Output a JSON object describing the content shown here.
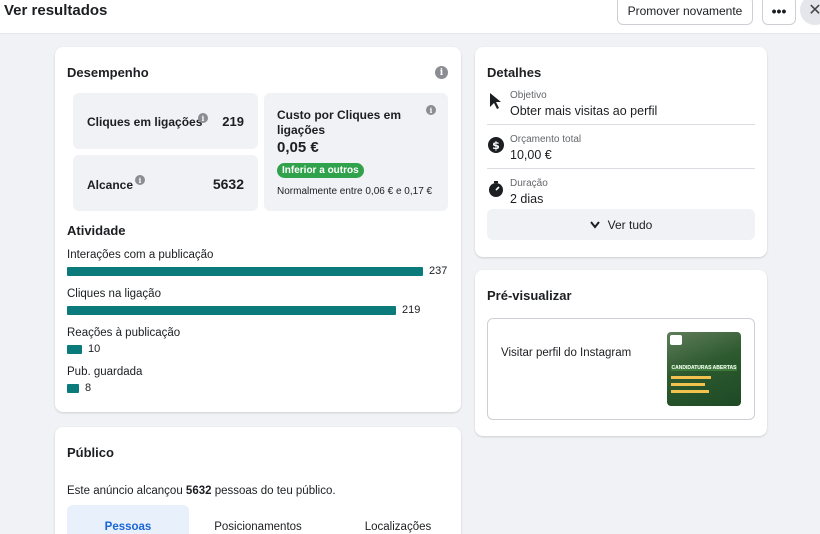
{
  "header": {
    "title": "Ver resultados",
    "promote_label": "Promover novamente",
    "more_label": "•••",
    "close_label": "✕"
  },
  "performance": {
    "title": "Desempenho",
    "link_clicks_label": "Cliques em ligações",
    "link_clicks_value": "219",
    "reach_label": "Alcance",
    "reach_value": "5632",
    "cpc_label": "Custo por Cliques em ligações",
    "cpc_value": "0,05 €",
    "cpc_badge": "Inferior a outros",
    "cpc_note": "Normalmente entre 0,06 € e 0,17 €"
  },
  "activity": {
    "title": "Atividade",
    "items": [
      {
        "label": "Interações com a publicação",
        "value": 237
      },
      {
        "label": "Cliques na ligação",
        "value": 219
      },
      {
        "label": "Reações à publicação",
        "value": 10
      },
      {
        "label": "Pub. guardada",
        "value": 8
      }
    ],
    "bar_color": "#0a7b7a"
  },
  "details": {
    "title": "Detalhes",
    "rows": [
      {
        "icon": "cursor-icon",
        "label": "Objetivo",
        "value": "Obter mais visitas ao perfil"
      },
      {
        "icon": "dollar-icon",
        "label": "Orçamento total",
        "value": "10,00 €"
      },
      {
        "icon": "stopwatch-icon",
        "label": "Duração",
        "value": "2 dias"
      }
    ],
    "see_all_label": "Ver tudo"
  },
  "preview": {
    "title": "Pré-visualizar",
    "cta": "Visitar perfil do Instagram",
    "thumb_text": "CANDIDATURAS ABERTAS"
  },
  "audience": {
    "title": "Público",
    "summary_prefix": "Este anúncio alcançou ",
    "summary_count": "5632",
    "summary_suffix": " pessoas do teu público.",
    "tabs": [
      "Pessoas",
      "Posicionamentos",
      "Localizações"
    ]
  }
}
